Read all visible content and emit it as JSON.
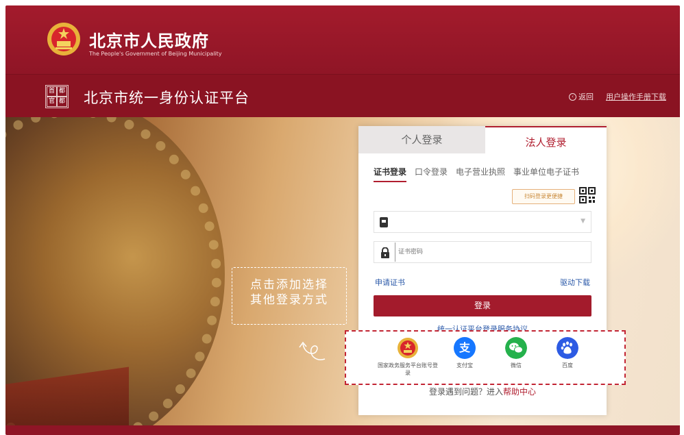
{
  "header": {
    "gov_title": "北京市人民政府",
    "gov_subtitle": "The People's Government of Beijing Municipality"
  },
  "subheader": {
    "logo_chars": [
      "首",
      "都",
      "官",
      "都"
    ],
    "platform_title": "北京市统一身份认证平台",
    "back_label": "返回",
    "manual_label": "用户操作手册下载"
  },
  "hint": {
    "line1": "点击添加选择",
    "line2": "其他登录方式"
  },
  "login": {
    "tabs": [
      {
        "label": "个人登录"
      },
      {
        "label": "法人登录"
      }
    ],
    "subtabs": [
      {
        "label": "证书登录"
      },
      {
        "label": "口令登录"
      },
      {
        "label": "电子营业执照"
      },
      {
        "label": "事业单位电子证书"
      }
    ],
    "qr_tip": "扫码登录更便捷",
    "cert_select_value": "",
    "pwd_placeholder": "证书密码",
    "apply_cert": "申请证书",
    "driver_download": "驱动下载",
    "login_button": "登录",
    "agreement": "统一认证平台登录服务协议"
  },
  "other_logins": [
    {
      "label": "国家政务服务平台账号登录",
      "icon": "national-emblem-icon",
      "color": "#e2452a"
    },
    {
      "label": "支付宝",
      "icon": "alipay-icon",
      "color": "#1677ff"
    },
    {
      "label": "微信",
      "icon": "wechat-icon",
      "color": "#25b14c"
    },
    {
      "label": "百度",
      "icon": "baidu-icon",
      "color": "#2d5be3"
    }
  ],
  "help": {
    "prefix": "登录遇到问题？进入",
    "link": "帮助中心"
  },
  "colors": {
    "brand_red": "#a31b2c",
    "link_blue": "#2a58a8"
  }
}
